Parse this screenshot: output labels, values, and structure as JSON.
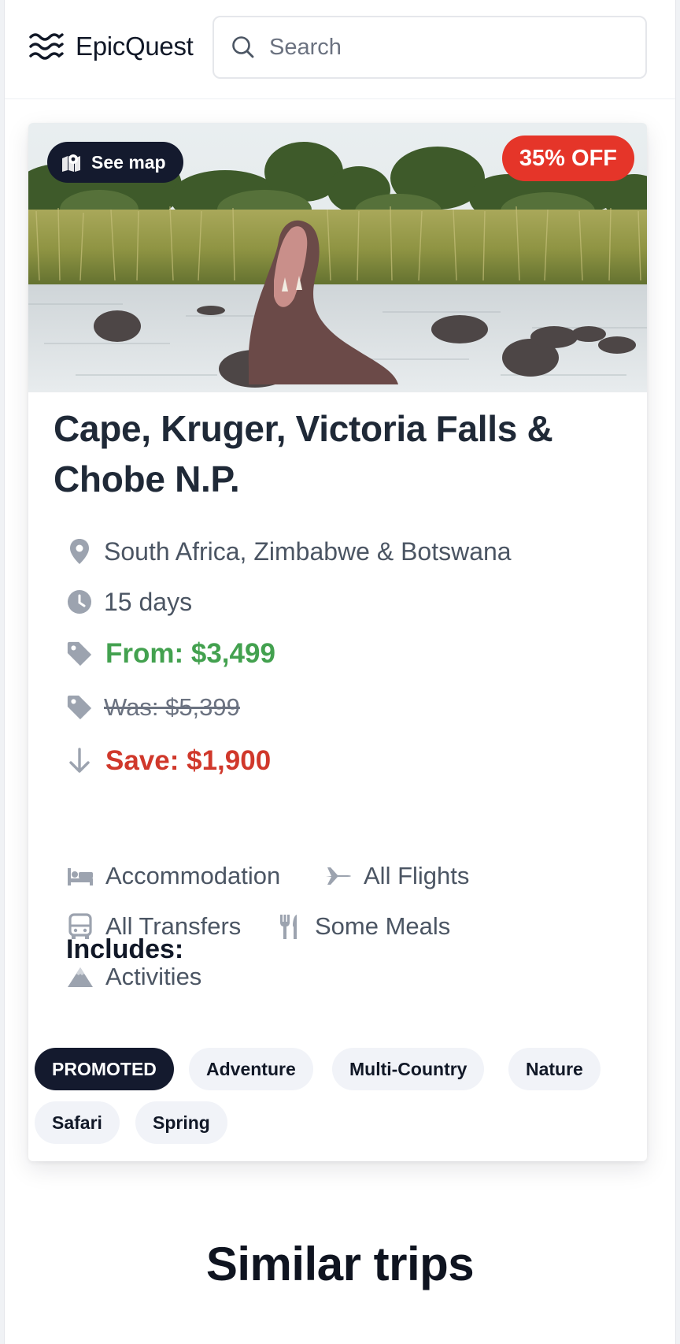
{
  "header": {
    "logo_text": "EpicQuest",
    "logo_icon": "waves-icon",
    "search_placeholder": "Search",
    "search_icon": "search-icon"
  },
  "trip": {
    "see_map_label": "See map",
    "discount_badge": "35% OFF",
    "title": "Cape, Kruger, Victoria Falls & Chobe N.P.",
    "location": "South Africa, Zimbabwe & Botswana",
    "duration": "15 days",
    "price_from": "From: $3,499",
    "price_was": "Was: $5,399",
    "savings": "Save: $1,900",
    "includes_heading": "Includes:",
    "includes": [
      {
        "label": "Accommodation",
        "icon": "bed-icon"
      },
      {
        "label": "All Flights",
        "icon": "plane-icon"
      },
      {
        "label": "All Transfers",
        "icon": "bus-icon"
      },
      {
        "label": "Some Meals",
        "icon": "utensils-icon"
      },
      {
        "label": "Activities",
        "icon": "mountain-icon"
      }
    ],
    "tags": [
      "PROMOTED",
      "Adventure",
      "Multi-Country",
      "Nature",
      "Safari",
      "Spring"
    ]
  },
  "similar_heading": "Similar trips",
  "colors": {
    "price_green": "#43a14f",
    "save_red": "#d0382b",
    "discount_red": "#e53529",
    "dark_pill": "#141a2e",
    "tag_bg": "#f1f3f8",
    "icon_gray": "#9ca3af"
  }
}
